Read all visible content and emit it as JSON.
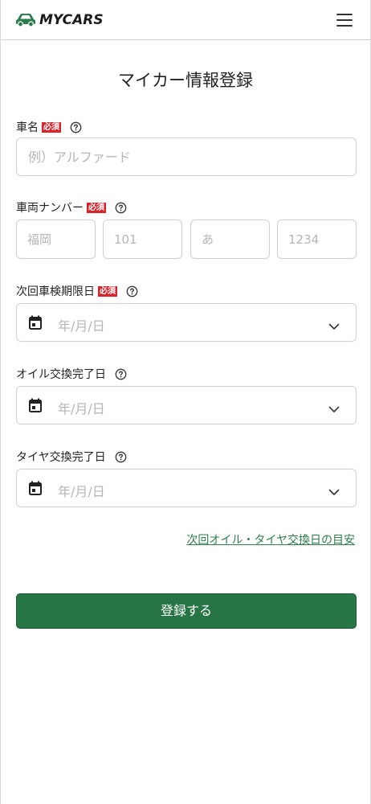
{
  "header": {
    "logo_text": "MYCARS",
    "brand_color": "#2e7d4a"
  },
  "page": {
    "title": "マイカー情報登録"
  },
  "form": {
    "required_badge": "必須",
    "car_name": {
      "label": "車名",
      "required": true,
      "placeholder": "例）アルファード"
    },
    "plate": {
      "label": "車両ナンバー",
      "required": true,
      "placeholders": [
        "福岡",
        "101",
        "あ",
        "1234"
      ]
    },
    "inspection_date": {
      "label": "次回車検期限日",
      "required": true,
      "placeholder": "年/月/日"
    },
    "oil_date": {
      "label": "オイル交換完了日",
      "required": false,
      "placeholder": "年/月/日"
    },
    "tire_date": {
      "label": "タイヤ交換完了日",
      "required": false,
      "placeholder": "年/月/日"
    },
    "guide_link": "次回オイル・タイヤ交換日の目安",
    "submit_label": "登録する"
  },
  "colors": {
    "accent": "#277545",
    "required_badge": "#d9222a",
    "border": "#cfcfcf",
    "placeholder": "#b5b5b5"
  },
  "icons": {
    "logo": "car-icon",
    "menu": "hamburger-menu-icon",
    "help": "question-circle-icon",
    "calendar": "calendar-icon",
    "dropdown": "chevron-down-icon"
  }
}
